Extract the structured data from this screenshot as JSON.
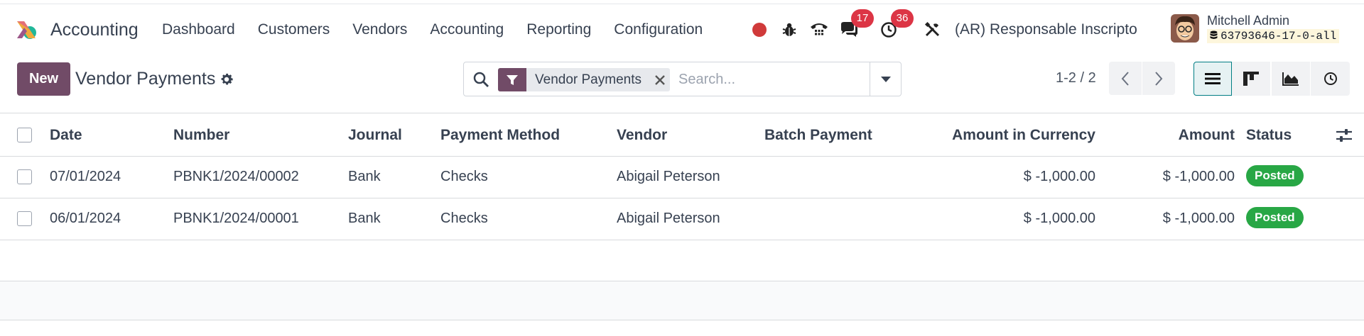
{
  "navbar": {
    "app_name": "Accounting",
    "menu": [
      "Dashboard",
      "Customers",
      "Vendors",
      "Accounting",
      "Reporting",
      "Configuration"
    ],
    "messages_count": "17",
    "activities_count": "36",
    "company": "(AR) Responsable Inscripto",
    "user_name": "Mitchell Admin",
    "database": "63793646-17-0-all"
  },
  "control_panel": {
    "new_label": "New",
    "title": "Vendor Payments",
    "facet_label": "Vendor Payments",
    "search_placeholder": "Search...",
    "pager": "1-2 / 2"
  },
  "table": {
    "columns": [
      "Date",
      "Number",
      "Journal",
      "Payment Method",
      "Vendor",
      "Batch Payment",
      "Amount in Currency",
      "Amount",
      "Status"
    ],
    "rows": [
      {
        "date": "07/01/2024",
        "number": "PBNK1/2024/00002",
        "journal": "Bank",
        "method": "Checks",
        "vendor": "Abigail Peterson",
        "batch": "",
        "amount_currency": "$ -1,000.00",
        "amount": "$ -1,000.00",
        "status": "Posted"
      },
      {
        "date": "06/01/2024",
        "number": "PBNK1/2024/00001",
        "journal": "Bank",
        "method": "Checks",
        "vendor": "Abigail Peterson",
        "batch": "",
        "amount_currency": "$ -1,000.00",
        "amount": "$ -1,000.00",
        "status": "Posted"
      }
    ]
  },
  "colors": {
    "brand": "#714b67",
    "accent": "#017e84",
    "posted": "#28a745",
    "badge": "#dc3545"
  },
  "icons": [
    "app-logo-icon",
    "record-icon",
    "debug-icon",
    "phone-icon",
    "chat-icon",
    "activity-clock-icon",
    "tools-icon",
    "gear-icon",
    "search-icon",
    "filter-icon",
    "close-icon",
    "caret-down-icon",
    "chevron-left-icon",
    "chevron-right-icon",
    "list-view-icon",
    "kanban-view-icon",
    "graph-view-icon",
    "activity-view-icon",
    "optional-columns-icon",
    "database-icon"
  ]
}
